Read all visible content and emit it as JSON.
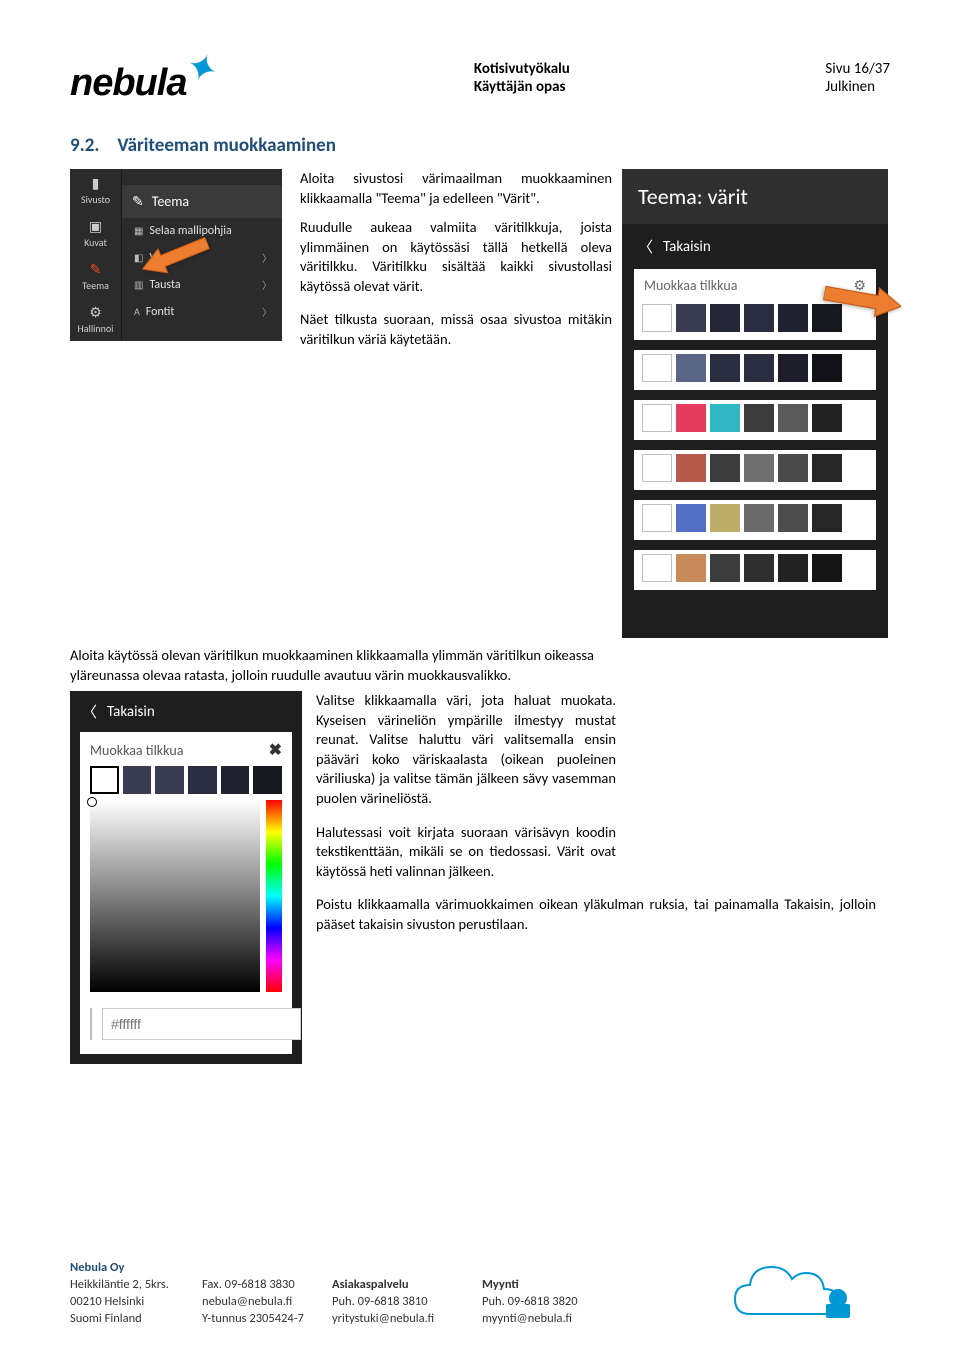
{
  "brand": {
    "name": "nebula"
  },
  "header": {
    "title": "Kotisivutyökalu",
    "subtitle": "Käyttäjän opas",
    "page_label": "Sivu 16/37",
    "visibility": "Julkinen"
  },
  "section": {
    "number": "9.2.",
    "title": "Väriteeman muokkaaminen"
  },
  "body": {
    "p1": "Aloita sivustosi värimaailman muokkaaminen klikkaamalla \"Teema\" ja edelleen \"Värit\".",
    "p2": "Ruudulle aukeaa valmiita väritilkkuja, joista ylimmäinen on käytössäsi tällä hetkellä oleva väritilkku. Väritilkku sisältää kaikki sivustollasi käytössä olevat värit.",
    "p3": "Näet tilkusta suoraan, missä osaa sivustoa mitäkin väritilkun väriä käytetään.",
    "p4": "Aloita käytössä olevan väritilkun muokkaaminen klikkaamalla ylimmän väritilkun oikeassa yläreunassa olevaa ratasta, jolloin ruudulle avautuu värin muokkausvalikko.",
    "p5": "Valitse klikkaamalla väri, jota haluat muokata. Kyseisen värineliön ympärille ilmestyy mustat reunat. Valitse haluttu väri valitsemalla ensin pääväri koko väriskaalasta (oikean puoleinen väriliuska) ja valitse tämän jälkeen sävy vasemman puolen värineliöstä.",
    "p6": "Halutessasi voit kirjata suoraan värisävyn koodin tekstikenttään, mikäli se on tiedossasi. Värit ovat käytössä heti valinnan jälkeen.",
    "p7": "Poistu klikkaamalla värimuokkaimen oikean yläkulman ruksia, tai painamalla Takaisin, jolloin pääset takaisin sivuston perustilaan."
  },
  "sidebar": {
    "panel_header": "Teema",
    "nav": [
      {
        "label": "Sivusto"
      },
      {
        "label": "Kuvat"
      },
      {
        "label": "Teema"
      },
      {
        "label": "Hallinnoi"
      }
    ],
    "items": [
      {
        "label": "Selaa mallipohjia"
      },
      {
        "label": "Värit"
      },
      {
        "label": "Tausta"
      },
      {
        "label": "Fontit"
      }
    ]
  },
  "teema": {
    "title": "Teema: värit",
    "back": "Takaisin",
    "card_title": "Muokkaa tilkkua",
    "rows": [
      [
        "#ffffff",
        "#3a3d52",
        "#26283a",
        "#2a2c3f",
        "#202230",
        "#16171f"
      ],
      [
        "#ffffff",
        "#5b6586",
        "#2a2c3f",
        "#2a2c3f",
        "#1d1e2a",
        "#121218"
      ],
      [
        "#ffffff",
        "#e63b5b",
        "#2fb7c3",
        "#3b3b3b",
        "#5a5a5a",
        "#222222"
      ],
      [
        "#ffffff",
        "#b55a4a",
        "#3b3b3b",
        "#6f6f6f",
        "#4a4a4a",
        "#262626"
      ],
      [
        "#ffffff",
        "#5470c6",
        "#beae6a",
        "#6a6a6a",
        "#4d4d4d",
        "#262626"
      ],
      [
        "#ffffff",
        "#c88a5a",
        "#3b3b3b",
        "#2f2f2f",
        "#222222",
        "#151515"
      ]
    ]
  },
  "picker": {
    "back": "Takaisin",
    "card_title": "Muokkaa tilkkua",
    "swatches": [
      "#ffffff",
      "#3a3d52",
      "#3a3d52",
      "#2a2c3f",
      "#202230",
      "#16171f"
    ],
    "selected_index": 0,
    "hex_value": "#ffffff"
  },
  "footer": {
    "company": "Nebula Oy",
    "col1": [
      "Heikkiläntie 2, 5krs.",
      "00210 Helsinki",
      "Suomi Finland"
    ],
    "col2": [
      "Fax. 09-6818 3830",
      "nebula@nebula.fi",
      "Y-tunnus 2305424-7"
    ],
    "col3_head": "Asiakaspalvelu",
    "col3": [
      "Puh. 09-6818 3810",
      "yritystuki@nebula.fi"
    ],
    "col4_head": "Myynti",
    "col4": [
      "Puh. 09-6818 3820",
      "myynti@nebula.fi"
    ]
  }
}
